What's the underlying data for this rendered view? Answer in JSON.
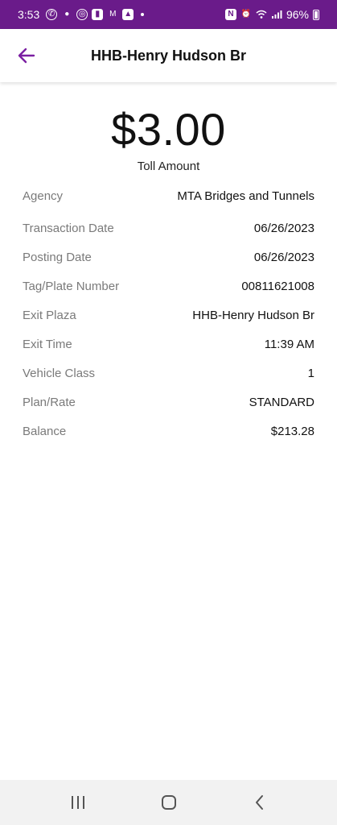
{
  "status_bar": {
    "time": "3:53",
    "battery": "96%",
    "accent": "#6a1b8a",
    "left_icons": [
      "whatsapp-icon",
      "chat-icon",
      "browser-icon",
      "app-icon",
      "gmail-icon",
      "photos-icon"
    ],
    "right_icons": [
      "nfc-icon",
      "alarm-icon",
      "wifi-icon",
      "signal-icon",
      "battery-icon"
    ]
  },
  "app_bar": {
    "title": "HHB-Henry Hudson Br",
    "back_icon": "arrow-left-icon",
    "back_icon_color": "#7b1fa2"
  },
  "toll": {
    "amount": "$3.00",
    "label": "Toll Amount"
  },
  "details": [
    {
      "label": "Agency",
      "value": "MTA Bridges and Tunnels"
    },
    {
      "label": "Transaction Date",
      "value": "06/26/2023"
    },
    {
      "label": "Posting Date",
      "value": "06/26/2023"
    },
    {
      "label": "Tag/Plate Number",
      "value": "00811621008"
    },
    {
      "label": "Exit Plaza",
      "value": "HHB-Henry Hudson Br"
    },
    {
      "label": "Exit Time",
      "value": "11:39 AM"
    },
    {
      "label": "Vehicle Class",
      "value": "1"
    },
    {
      "label": "Plan/Rate",
      "value": "STANDARD"
    },
    {
      "label": "Balance",
      "value": "$213.28"
    }
  ],
  "nav_bar": {
    "buttons": [
      "recent-apps-icon",
      "home-icon",
      "back-icon"
    ]
  }
}
